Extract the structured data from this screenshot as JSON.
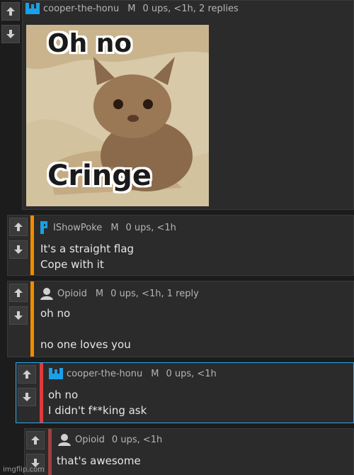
{
  "comments": [
    {
      "username": "cooper-the-honu",
      "mod": "M",
      "stats": "0 ups, <1h, 2 replies",
      "image_text": {
        "top": "Oh no",
        "bottom": "Cringe"
      }
    },
    {
      "username": "IShowPoke",
      "mod": "M",
      "stats": "0 ups, <1h",
      "lines": [
        "It's a straight flag",
        "Cope with it"
      ],
      "accent": "#f08c00"
    },
    {
      "username": "Opioid",
      "mod": "M",
      "stats": "0 ups, <1h, 1 reply",
      "lines": [
        "oh no",
        "",
        "no one loves you"
      ],
      "accent": "#f08c00"
    },
    {
      "username": "cooper-the-honu",
      "mod": "M",
      "stats": "0 ups, <1h",
      "lines": [
        "oh no",
        "I didn't f**king ask"
      ],
      "accent": "#e03a3a"
    },
    {
      "username": "Opioid",
      "stats": "0 ups, <1h",
      "lines": [
        "that's awesome"
      ],
      "accent": "#a04040"
    }
  ],
  "watermark": "imgflip.com",
  "colors": {
    "link_blue": "#1aa0e8",
    "border_blue": "#2aa8e8"
  }
}
